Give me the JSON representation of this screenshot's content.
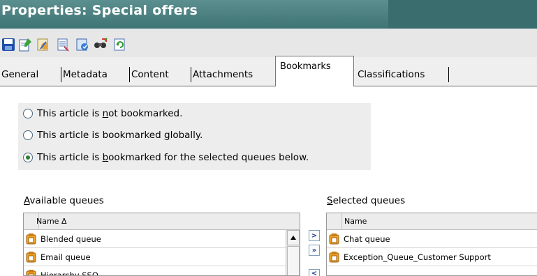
{
  "window": {
    "title": "Properties: Special offers"
  },
  "toolbar": {
    "icons": [
      "save-icon",
      "new-document-icon",
      "edit-icon",
      "document-list-icon",
      "queue-icon",
      "find-replace-icon",
      "refresh-icon"
    ]
  },
  "tabs": [
    {
      "label": "General",
      "active": false
    },
    {
      "label": "Metadata",
      "active": false
    },
    {
      "label": "Content",
      "active": false
    },
    {
      "label": "Attachments",
      "active": false
    },
    {
      "label": "Bookmarks",
      "active": true
    },
    {
      "label": "Classifications",
      "active": false
    }
  ],
  "bookmark_options": {
    "selected_index": 2,
    "options": [
      {
        "prefix": "This article is ",
        "mnemonic": "n",
        "suffix": "ot bookmarked."
      },
      {
        "prefix": "This article is bookmarked ",
        "mnemonic": "g",
        "suffix": "lobally."
      },
      {
        "prefix": "This article is ",
        "mnemonic": "b",
        "suffix": "ookmarked for the selected queues below."
      }
    ]
  },
  "available_queues": {
    "label_mnemonic": "A",
    "label_rest": "vailable queues",
    "column_header": "Name Δ",
    "rows": [
      "Blended queue",
      "Email queue",
      "Hierarchy SSO"
    ]
  },
  "selected_queues": {
    "label_mnemonic": "S",
    "label_rest": "elected queues",
    "column_header": "Name",
    "rows": [
      "Chat queue",
      "Exception_Queue_Customer Support"
    ]
  },
  "move_buttons": {
    "add": ">",
    "add_all": "»",
    "remove": "<"
  },
  "colors": {
    "titlebar": "#4a7f7f",
    "toolbar": "#e7e7e7",
    "panel": "#ededed",
    "radio_selected": "#2e7d32"
  }
}
